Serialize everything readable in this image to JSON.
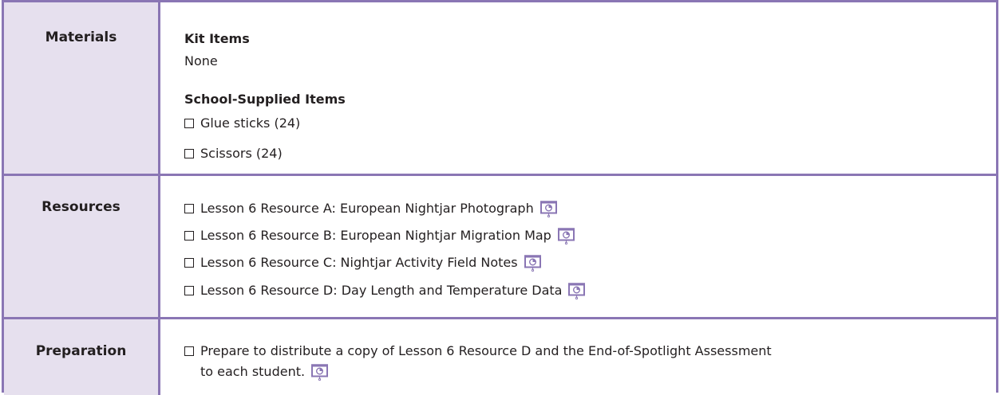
{
  "materials": {
    "heading": "Materials",
    "kit_items_title": "Kit Items",
    "kit_items_value": "None",
    "school_items_title": "School-Supplied Items",
    "school_items": [
      "Glue sticks (24)",
      "Scissors (24)"
    ]
  },
  "resources": {
    "heading": "Resources",
    "items": [
      "Lesson 6 Resource A: European Nightjar Photograph",
      "Lesson 6 Resource B: European Nightjar Migration Map",
      "Lesson 6 Resource C: Nightjar Activity Field Notes",
      "Lesson 6 Resource D: Day Length and Temperature Data"
    ]
  },
  "preparation": {
    "heading": "Preparation",
    "line1": "Prepare to distribute a copy of Lesson 6 Resource D and the End-of-Spotlight Assessment",
    "line2": "to each student."
  },
  "icons": {
    "checkbox": "checkbox-icon",
    "presentation": "presentation-screen-icon"
  },
  "colors": {
    "border": "#8a76b4",
    "header_bg": "#e6e0ee"
  }
}
